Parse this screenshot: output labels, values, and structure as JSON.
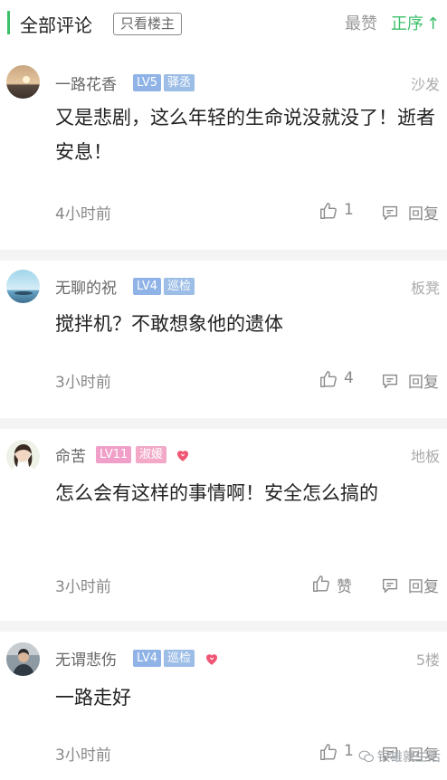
{
  "header": {
    "title": "全部评论",
    "only_host": "只看楼主",
    "sort_hot": "最赞",
    "sort_time": "正序",
    "sort_time_arrow": "↑",
    "accent_color": "#3cc06a"
  },
  "comments": [
    {
      "username": "一路花香",
      "level": "LV5",
      "role": "驿丞",
      "floor": "沙发",
      "content": "又是悲剧，这么年轻的生命说没就没了！逝者安息！",
      "time": "4小时前",
      "like_count": "1",
      "reply_label": "回复"
    },
    {
      "username": "无聊的祝",
      "level": "LV4",
      "role": "巡检",
      "floor": "板凳",
      "content": "搅拌机？不敢想象他的遗体",
      "time": "3小时前",
      "like_count": "4",
      "reply_label": "回复"
    },
    {
      "username": "命苦",
      "level": "LV11",
      "role": "淑媛",
      "floor": "地板",
      "content": "怎么会有这样的事情啊！安全怎么搞的",
      "time": "3小时前",
      "like_count": "赞",
      "reply_label": "回复"
    },
    {
      "username": "无谓悲伤",
      "level": "LV4",
      "role": "巡检",
      "floor": "5楼",
      "content": "一路走好",
      "time": "3小时前",
      "like_count": "1",
      "reply_label": "回复"
    }
  ],
  "watermark": "银雄就生活"
}
